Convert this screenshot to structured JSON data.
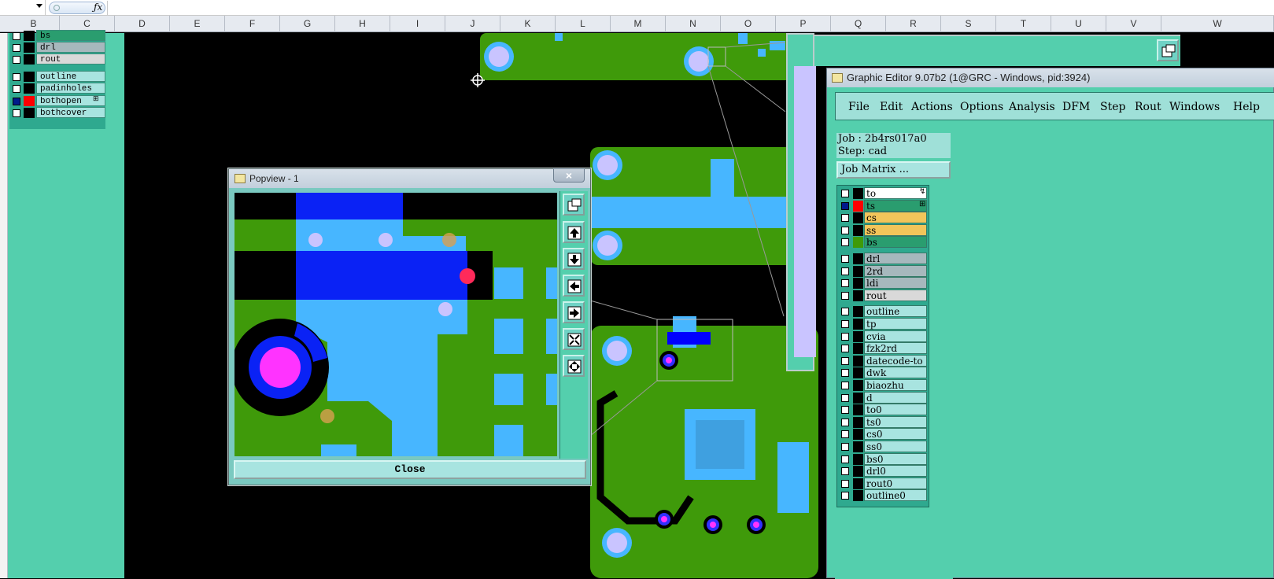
{
  "spreadsheet": {
    "formula_icon": "ƒx",
    "columns": [
      "B",
      "C",
      "D",
      "E",
      "F",
      "G",
      "H",
      "I",
      "J",
      "K",
      "L",
      "M",
      "N",
      "O",
      "P",
      "Q",
      "R",
      "S",
      "T",
      "U",
      "V",
      "W"
    ]
  },
  "left_layers": [
    {
      "name": "bs",
      "color": "#2a9d6f"
    },
    {
      "name": "drl",
      "color": "#a7b8bd"
    },
    {
      "name": "rout",
      "color": "#d9d9d9"
    },
    {
      "name": "outline",
      "color": "#a8e4e0"
    },
    {
      "name": "padinholes",
      "color": "#a8e4e0"
    },
    {
      "name": "bothopen",
      "color": "#a8e4e0",
      "marker": "⊞"
    },
    {
      "name": "bothcover",
      "color": "#a8e4e0"
    }
  ],
  "popview": {
    "title": "Popview - 1",
    "close_label": "Close",
    "close_x": "×",
    "tools": [
      "fit-icon",
      "pan-up-icon",
      "pan-down-icon",
      "pan-left-icon",
      "pan-right-icon",
      "zoom-in-icon",
      "zoom-out-icon"
    ]
  },
  "graphic_editor": {
    "title": "Graphic Editor 9.07b2 (1@GRC - Windows, pid:3924)",
    "menu": [
      "File",
      "Edit",
      "Actions",
      "Options",
      "Analysis",
      "DFM",
      "Step",
      "Rout",
      "Windows",
      "Help"
    ],
    "job": "Job : 2b4rs017a0",
    "step": "Step: cad",
    "job_matrix_button": "Job Matrix ...",
    "layers": [
      {
        "name": "to",
        "color": "#ffffff",
        "marker": "↯"
      },
      {
        "name": "ts",
        "color": "#2a9d6f",
        "marker": "⊞",
        "active": true
      },
      {
        "name": "cs",
        "color": "#f2c55a"
      },
      {
        "name": "ss",
        "color": "#f2c55a"
      },
      {
        "name": "bs",
        "color": "#2a9d6f"
      },
      {
        "name": "drl",
        "color": "#a7b8bd"
      },
      {
        "name": "2rd",
        "color": "#a7b8bd"
      },
      {
        "name": "ldi",
        "color": "#a7b8bd"
      },
      {
        "name": "rout",
        "color": "#d9d9d9"
      },
      {
        "name": "outline",
        "color": "#a8e4e0"
      },
      {
        "name": "tp",
        "color": "#a8e4e0"
      },
      {
        "name": "cvia",
        "color": "#a8e4e0"
      },
      {
        "name": "fzk2rd",
        "color": "#a8e4e0"
      },
      {
        "name": "datecode-to",
        "color": "#a8e4e0"
      },
      {
        "name": "dwk",
        "color": "#a8e4e0"
      },
      {
        "name": "biaozhu",
        "color": "#a8e4e0"
      },
      {
        "name": "d",
        "color": "#a8e4e0"
      },
      {
        "name": "to0",
        "color": "#a8e4e0"
      },
      {
        "name": "ts0",
        "color": "#a8e4e0"
      },
      {
        "name": "cs0",
        "color": "#a8e4e0"
      },
      {
        "name": "ss0",
        "color": "#a8e4e0"
      },
      {
        "name": "bs0",
        "color": "#a8e4e0"
      },
      {
        "name": "drl0",
        "color": "#a8e4e0"
      },
      {
        "name": "rout0",
        "color": "#a8e4e0"
      },
      {
        "name": "outline0",
        "color": "#a8e4e0"
      }
    ]
  },
  "colors": {
    "pcb_green": "#3f9a0a",
    "pad_blue": "#47b6ff",
    "panel_teal": "#54cfad"
  }
}
